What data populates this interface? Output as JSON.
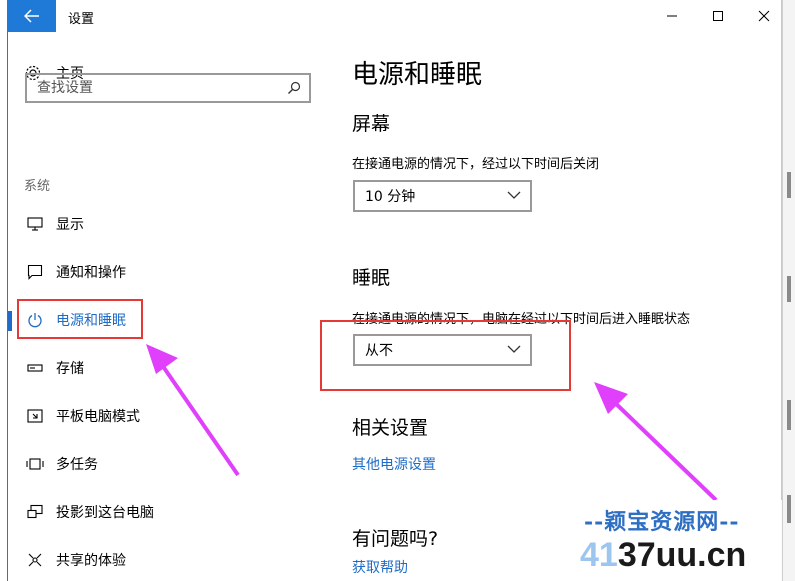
{
  "window": {
    "title": "设置"
  },
  "sidebar": {
    "home_label": "主页",
    "search_placeholder": "查找设置",
    "section_label": "系统",
    "items": [
      {
        "label": "显示",
        "icon": "display-icon"
      },
      {
        "label": "通知和操作",
        "icon": "notification-icon"
      },
      {
        "label": "电源和睡眠",
        "icon": "power-icon",
        "active": true
      },
      {
        "label": "存储",
        "icon": "storage-icon"
      },
      {
        "label": "平板电脑模式",
        "icon": "tablet-mode-icon"
      },
      {
        "label": "多任务",
        "icon": "multitasking-icon"
      },
      {
        "label": "投影到这台电脑",
        "icon": "project-icon"
      },
      {
        "label": "共享的体验",
        "icon": "shared-experience-icon"
      }
    ]
  },
  "main": {
    "title": "电源和睡眠",
    "screen": {
      "heading": "屏幕",
      "description": "在接通电源的情况下，经过以下时间后关闭",
      "value": "10 分钟"
    },
    "sleep": {
      "heading": "睡眠",
      "description": "在接通电源的情况下，电脑在经过以下时间后进入睡眠状态",
      "value": "从不"
    },
    "related": {
      "heading": "相关设置",
      "link": "其他电源设置"
    },
    "help": {
      "heading": "有问题吗?",
      "link": "获取帮助"
    }
  },
  "watermark": {
    "line1": "--颖宝资源网--",
    "line2_left": "41",
    "line2_main": "37uu.cn"
  },
  "colors": {
    "accent": "#1e6cc8",
    "back_button": "#1e7ad6",
    "highlight": "#e53935",
    "arrow": "#e040fb"
  }
}
